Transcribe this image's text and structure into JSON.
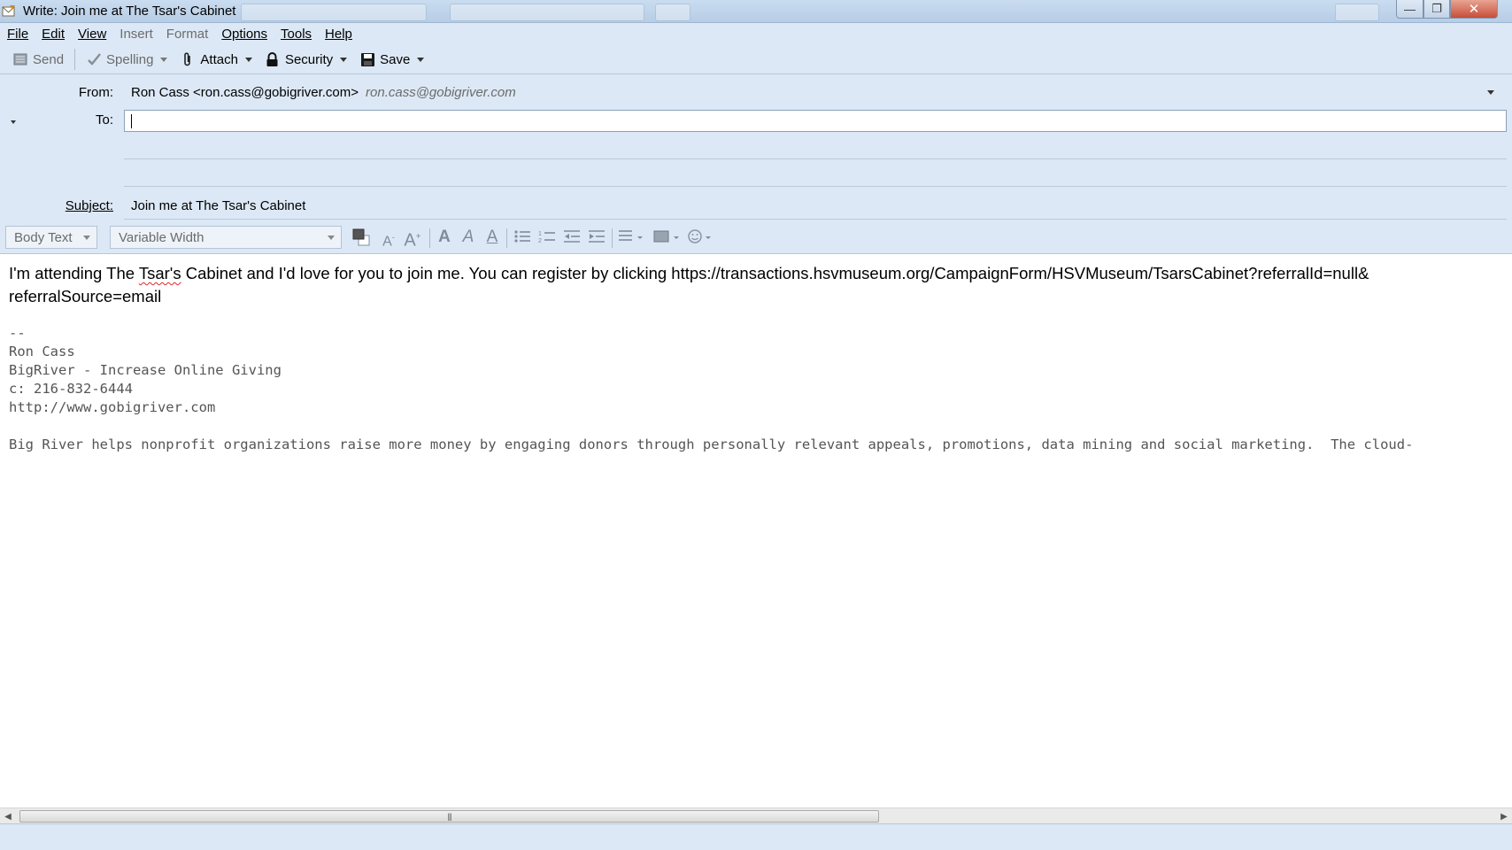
{
  "window": {
    "title": "Write: Join me at The Tsar's Cabinet",
    "min_label": "—",
    "restore_label": "❐",
    "close_label": "✕"
  },
  "menu": {
    "items": [
      {
        "label": "File",
        "disabled": false
      },
      {
        "label": "Edit",
        "disabled": false
      },
      {
        "label": "View",
        "disabled": false
      },
      {
        "label": "Insert",
        "disabled": true
      },
      {
        "label": "Format",
        "disabled": true
      },
      {
        "label": "Options",
        "disabled": false
      },
      {
        "label": "Tools",
        "disabled": false
      },
      {
        "label": "Help",
        "disabled": false
      }
    ]
  },
  "toolbar": {
    "send_label": "Send",
    "spelling_label": "Spelling",
    "attach_label": "Attach",
    "security_label": "Security",
    "save_label": "Save"
  },
  "header": {
    "from_label": "From:",
    "from_value": "Ron Cass <ron.cass@gobigriver.com>",
    "from_alt": "ron.cass@gobigriver.com",
    "to_label": "To:",
    "to_value": "",
    "subject_label": "Subject:",
    "subject_value": "Join me at The Tsar's Cabinet"
  },
  "format": {
    "paragraph_style": "Body Text",
    "font": "Variable Width"
  },
  "message": {
    "line1_before": "I'm attending The ",
    "line1_misspelled": "Tsar's",
    "line1_after": " Cabinet and I'd love for you to join me. You can register by clicking https://transactions.hsvmuseum.org/CampaignForm/HSVMuseum/TsarsCabinet?referralId=null&",
    "line2": "referralSource=email"
  },
  "signature": {
    "separator": "--",
    "name": "Ron Cass",
    "company": "BigRiver - Increase Online Giving",
    "phone": "c: 216-832-6444",
    "website": "http://www.gobigriver.com",
    "blurb": "Big River helps nonprofit organizations raise more money by engaging donors through personally relevant appeals, promotions, data mining and social marketing.  The cloud-"
  },
  "scrollbar": {
    "position_fraction": 0.0
  },
  "colors": {
    "chrome": "#dce8f5",
    "spell_error": "#d62b2b"
  }
}
